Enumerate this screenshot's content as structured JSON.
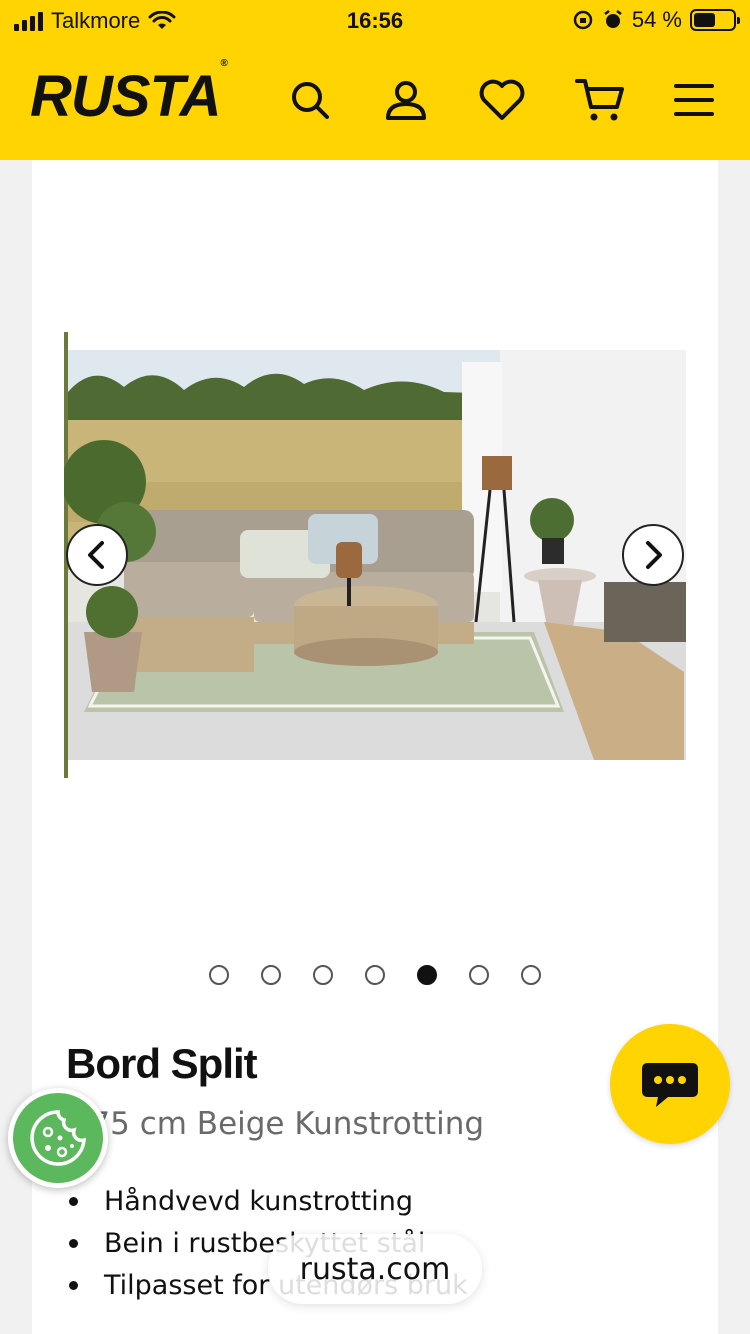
{
  "status_bar": {
    "carrier": "Talkmore",
    "time": "16:56",
    "battery": "54 %",
    "battery_level": 0.54
  },
  "header": {
    "logo": "RUSTA",
    "icons": [
      "search-icon",
      "account-icon",
      "heart-icon",
      "cart-icon",
      "menu-icon"
    ]
  },
  "gallery": {
    "image_count": 7,
    "active_index": 4
  },
  "product": {
    "title": "Bord Split",
    "subtitle": "Ø75 cm Beige Kunstrotting",
    "bullets": [
      "Håndvevd kunstrotting",
      "Bein i rustbeskyttet stål",
      "Tilpasset for utendørs bruk"
    ]
  },
  "browser": {
    "url": "rusta.com"
  },
  "colors": {
    "brand_yellow": "#ffd400",
    "cookie_green": "#5cb85c"
  }
}
